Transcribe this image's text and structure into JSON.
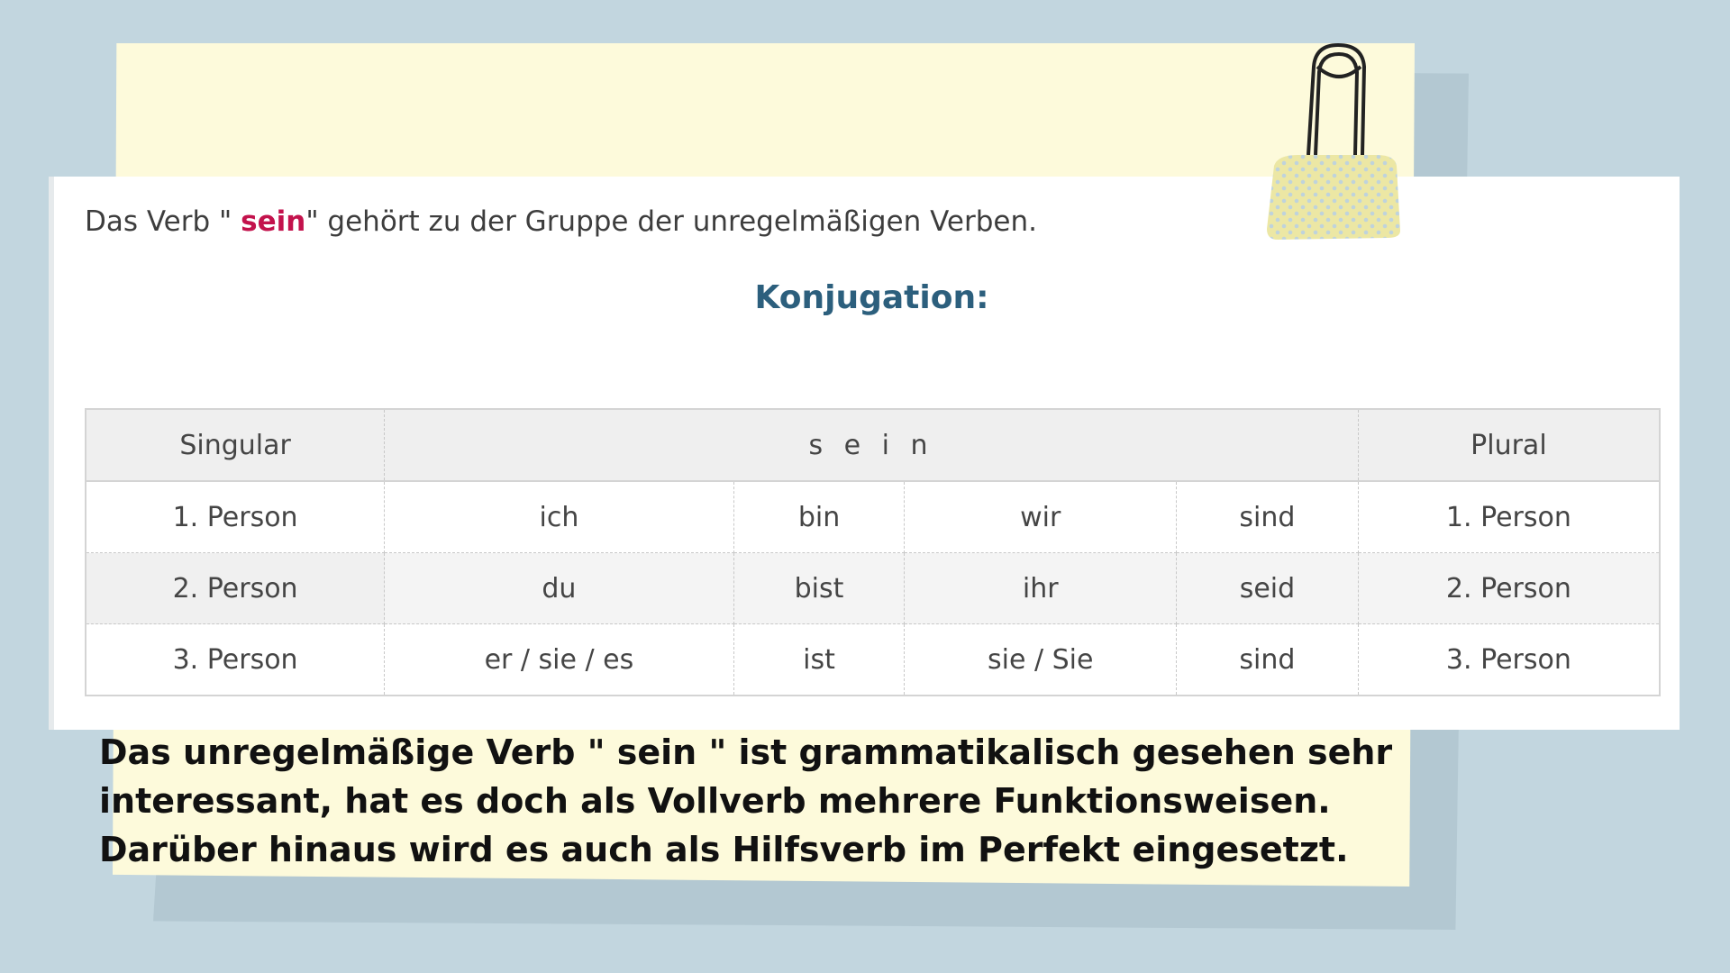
{
  "intro": {
    "prefix": "Das Verb \" ",
    "verb": "sein",
    "suffix": "\" gehört zu der Gruppe der unregelmäßigen Verben."
  },
  "heading": "Konjugation:",
  "table": {
    "header": {
      "left": "Singular",
      "center": "s e i n",
      "right": "Plural"
    },
    "rows": [
      {
        "left_person": "1. Person",
        "sing_pronoun": "ich",
        "sing_form": "bin",
        "plur_pronoun": "wir",
        "plur_form": "sind",
        "right_person": "1. Person"
      },
      {
        "left_person": "2. Person",
        "sing_pronoun": "du",
        "sing_form": "bist",
        "plur_pronoun": "ihr",
        "plur_form": "seid",
        "right_person": "2. Person"
      },
      {
        "left_person": "3. Person",
        "sing_pronoun": "er / sie / es",
        "sing_form": "ist",
        "plur_pronoun": "sie / Sie",
        "plur_form": "sind",
        "right_person": "3. Person"
      }
    ]
  },
  "bottom_text": {
    "line1": "Das unregelmäßige Verb \" sein \" ist grammatikalisch gesehen sehr",
    "line2": "interessant, hat es doch als Vollverb mehrere Funktionsweisen.",
    "line3": "Darüber hinaus wird es auch als Hilfsverb im Perfekt eingesetzt."
  },
  "colors": {
    "background": "#c2d6df",
    "note": "#fdfadb",
    "verb_accent": "#c3124c",
    "heading": "#2c5f7d",
    "clip_fabric": "#ece7a4"
  },
  "icons": [
    "binder-clip-icon"
  ]
}
